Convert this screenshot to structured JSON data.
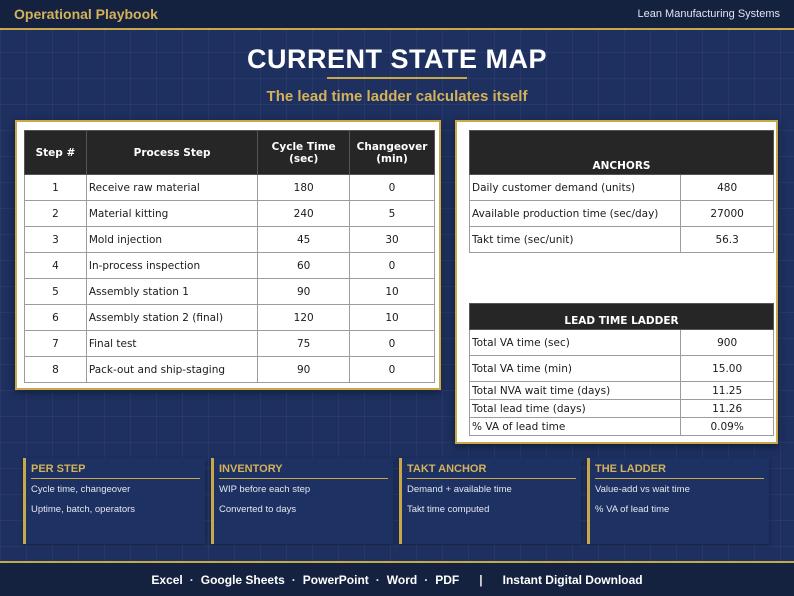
{
  "header": {
    "brand": "Operational Playbook",
    "tagline": "Lean Manufacturing Systems"
  },
  "title": "CURRENT STATE MAP",
  "subtitle": "The lead time ladder calculates itself",
  "process_table": {
    "headers": [
      "Step #",
      "Process Step",
      "Cycle Time (sec)",
      "Changeover (min)"
    ],
    "rows": [
      [
        "1",
        "Receive raw material",
        "180",
        "0"
      ],
      [
        "2",
        "Material kitting",
        "240",
        "5"
      ],
      [
        "3",
        "Mold injection",
        "45",
        "30"
      ],
      [
        "4",
        "In-process inspection",
        "60",
        "0"
      ],
      [
        "5",
        "Assembly station 1",
        "90",
        "10"
      ],
      [
        "6",
        "Assembly station 2 (final)",
        "120",
        "10"
      ],
      [
        "7",
        "Final test",
        "75",
        "0"
      ],
      [
        "8",
        "Pack-out and ship-staging",
        "90",
        "0"
      ]
    ]
  },
  "anchors": {
    "header": "ANCHORS",
    "rows": [
      [
        "Daily customer demand (units)",
        "480"
      ],
      [
        "Available production time (sec/day)",
        "27000"
      ],
      [
        "Takt time (sec/unit)",
        "56.3"
      ]
    ]
  },
  "ladder": {
    "header": "LEAD TIME LADDER",
    "rows": [
      [
        "Total VA time (sec)",
        "900"
      ],
      [
        "Total VA time (min)",
        "15.00"
      ],
      [
        "Total NVA wait time (days)",
        "11.25"
      ],
      [
        "Total lead time (days)",
        "11.26"
      ],
      [
        "% VA of lead time",
        "0.09%"
      ]
    ]
  },
  "cards": [
    {
      "title": "PER STEP",
      "line1": "Cycle time, changeover",
      "line2": "Uptime, batch, operators"
    },
    {
      "title": "INVENTORY",
      "line1": "WIP before each step",
      "line2": "Converted to days"
    },
    {
      "title": "TAKT ANCHOR",
      "line1": "Demand + available time",
      "line2": "Takt time computed"
    },
    {
      "title": "THE LADDER",
      "line1": "Value-add vs wait time",
      "line2": "% VA of lead time"
    }
  ],
  "footer": {
    "formats": [
      "Excel",
      "Google Sheets",
      "PowerPoint",
      "Word",
      "PDF"
    ],
    "download": "Instant Digital Download"
  }
}
